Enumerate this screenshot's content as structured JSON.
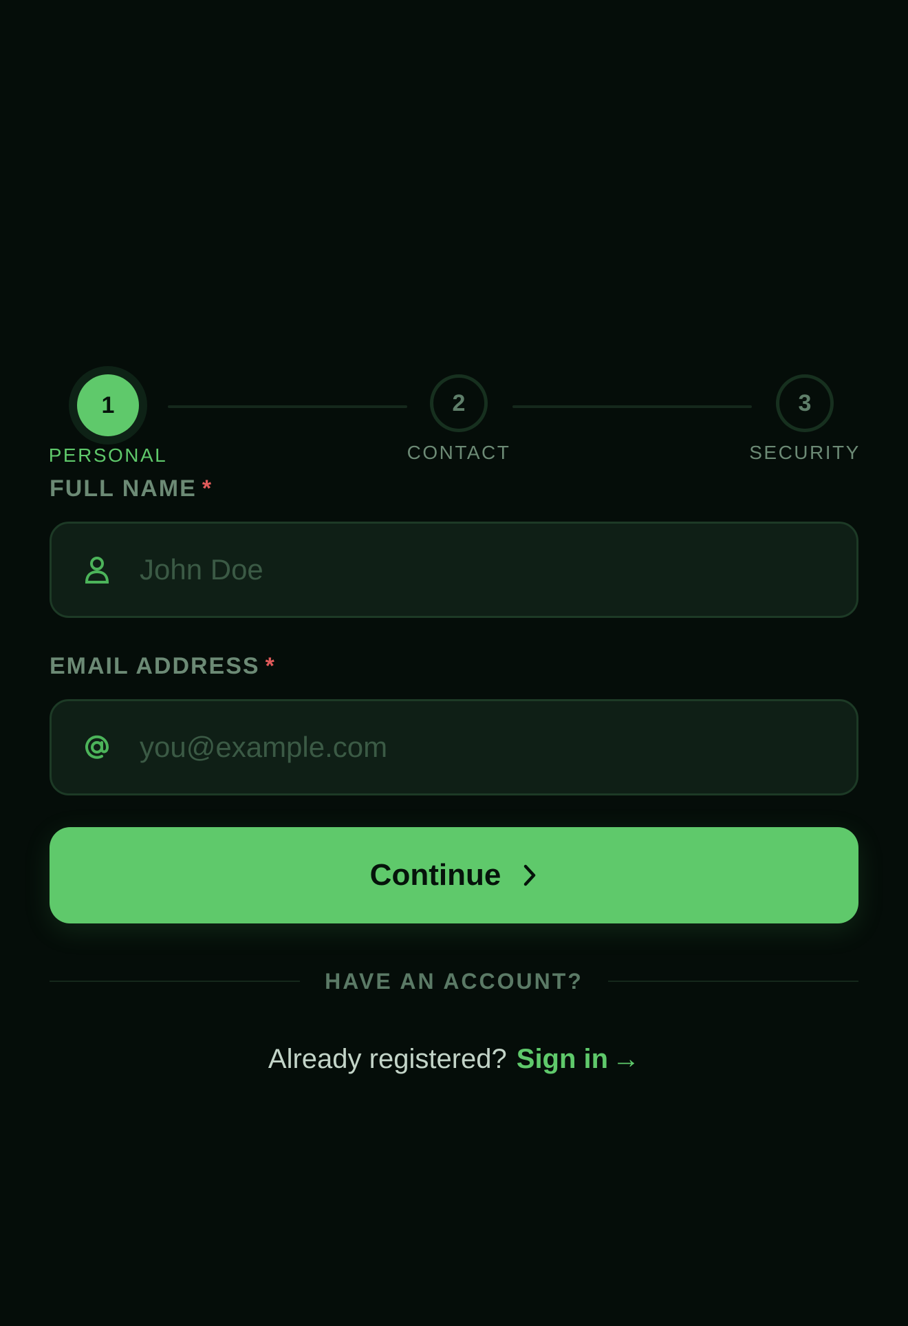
{
  "stepper": {
    "steps": [
      {
        "number": "1",
        "label": "PERSONAL",
        "active": true
      },
      {
        "number": "2",
        "label": "CONTACT",
        "active": false
      },
      {
        "number": "3",
        "label": "SECURITY",
        "active": false
      }
    ]
  },
  "fields": {
    "full_name": {
      "label": "FULL NAME",
      "required_mark": "*",
      "placeholder": "John Doe",
      "value": ""
    },
    "email": {
      "label": "EMAIL ADDRESS",
      "required_mark": "*",
      "placeholder": "you@example.com",
      "value": ""
    }
  },
  "actions": {
    "continue_label": "Continue"
  },
  "divider": {
    "text": "HAVE AN ACCOUNT?"
  },
  "signin": {
    "prompt": "Already registered?",
    "link_label": "Sign in",
    "arrow": "→"
  },
  "icons": {
    "full_name": "user-icon",
    "email": "at-sign-icon",
    "continue": "chevron-right-icon",
    "signin": "arrow-right-icon"
  },
  "colors": {
    "background": "#050d09",
    "accent": "#5fc96b",
    "required": "#e05a5a",
    "field_bg": "#0f1f16",
    "field_border": "#1d3a26"
  }
}
